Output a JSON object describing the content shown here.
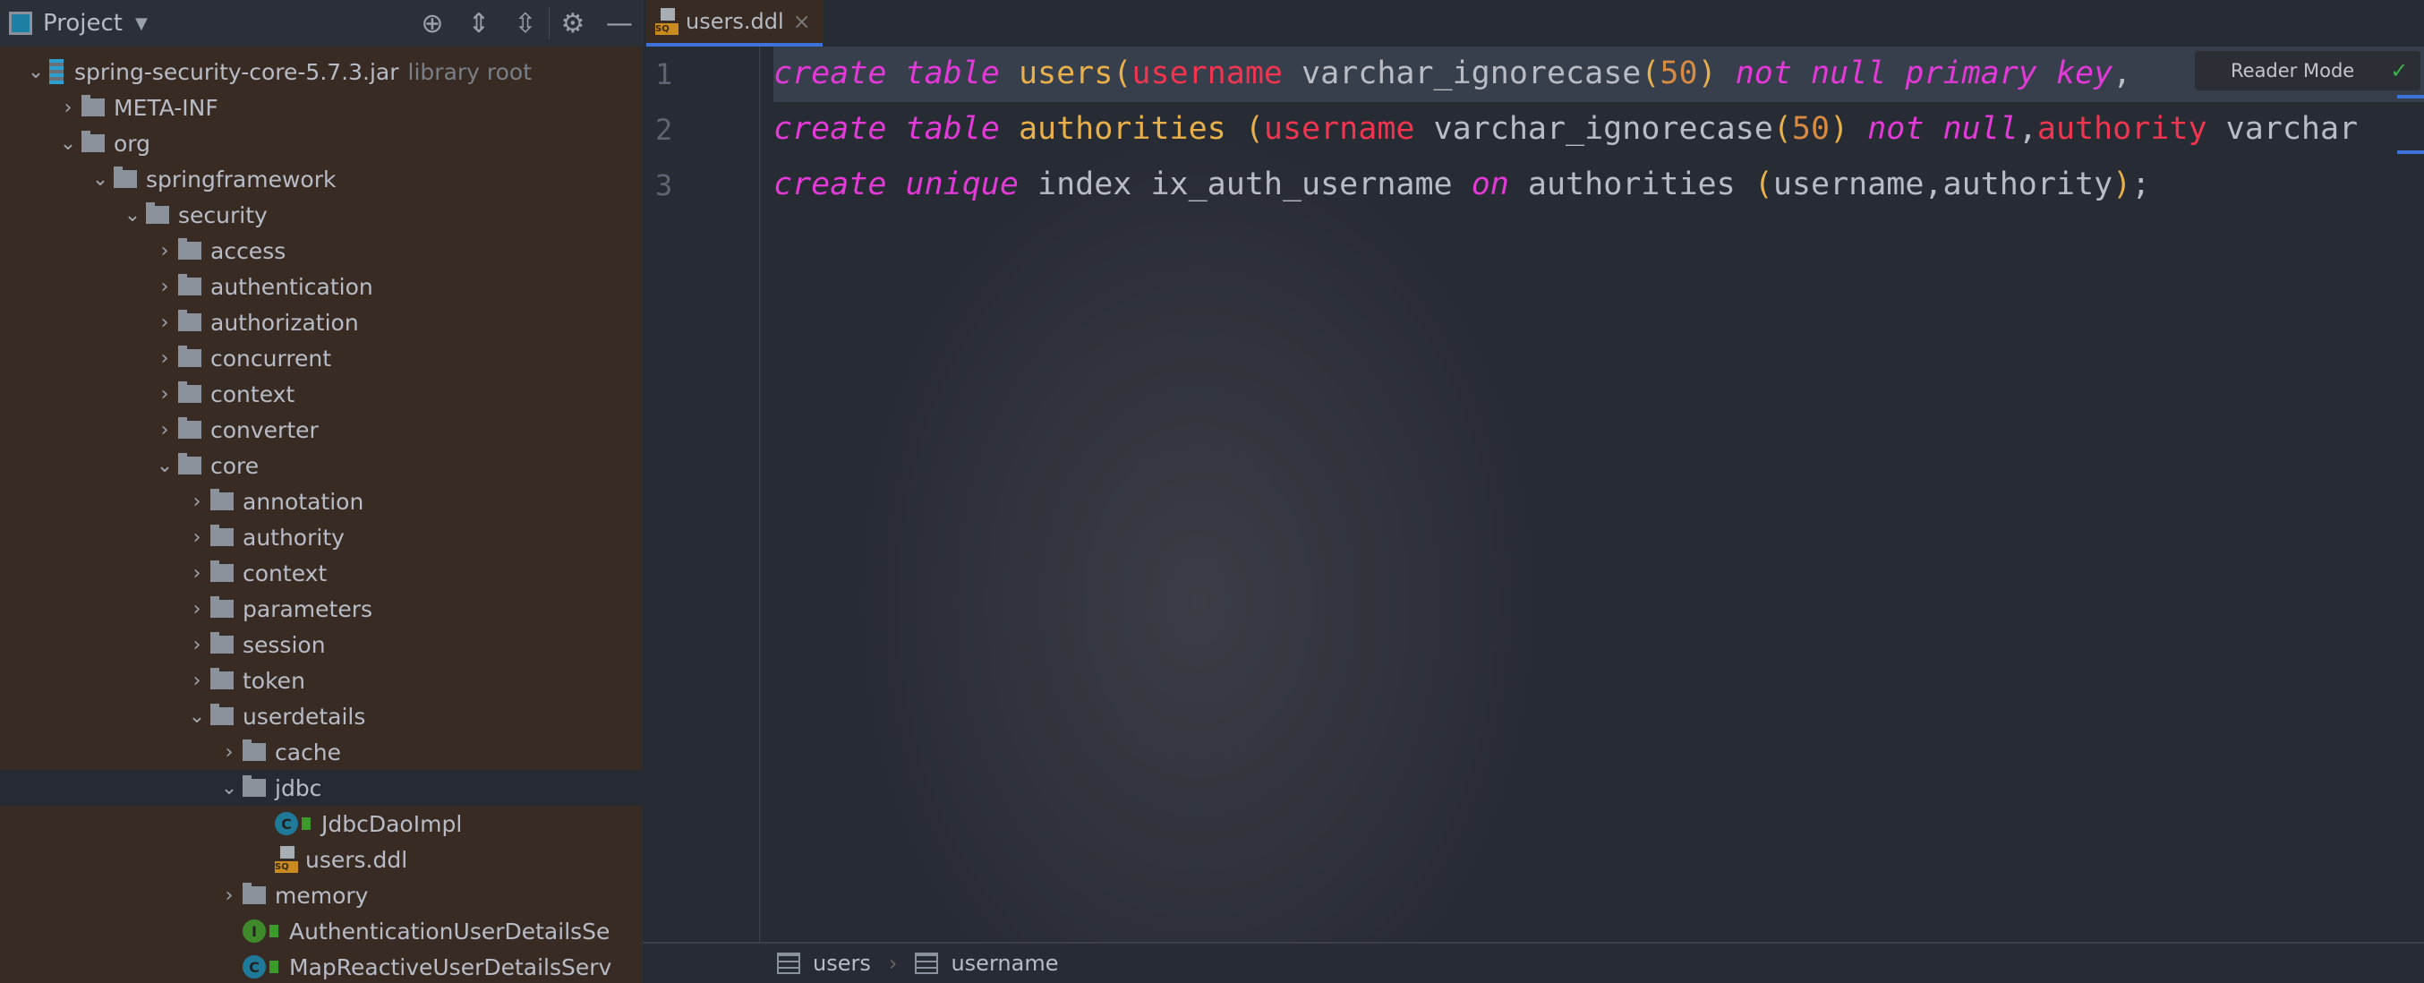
{
  "project_panel": {
    "title": "Project",
    "tools": [
      "locate-icon",
      "expand-all-icon",
      "collapse-all-icon",
      "gear-icon",
      "minimize-icon"
    ],
    "tree": [
      {
        "label": "spring-security-core-5.7.3.jar",
        "suffix": "library root",
        "level": 0,
        "type": "jar",
        "expanded": true
      },
      {
        "label": "META-INF",
        "level": 1,
        "type": "folder",
        "expanded": false
      },
      {
        "label": "org",
        "level": 1,
        "type": "folder",
        "expanded": true
      },
      {
        "label": "springframework",
        "level": 2,
        "type": "folder",
        "expanded": true
      },
      {
        "label": "security",
        "level": 3,
        "type": "folder",
        "expanded": true
      },
      {
        "label": "access",
        "level": 4,
        "type": "folder",
        "expanded": false
      },
      {
        "label": "authentication",
        "level": 4,
        "type": "folder",
        "expanded": false
      },
      {
        "label": "authorization",
        "level": 4,
        "type": "folder",
        "expanded": false
      },
      {
        "label": "concurrent",
        "level": 4,
        "type": "folder",
        "expanded": false
      },
      {
        "label": "context",
        "level": 4,
        "type": "folder",
        "expanded": false
      },
      {
        "label": "converter",
        "level": 4,
        "type": "folder",
        "expanded": false
      },
      {
        "label": "core",
        "level": 4,
        "type": "folder",
        "expanded": true
      },
      {
        "label": "annotation",
        "level": 5,
        "type": "folder",
        "expanded": false
      },
      {
        "label": "authority",
        "level": 5,
        "type": "folder",
        "expanded": false
      },
      {
        "label": "context",
        "level": 5,
        "type": "folder",
        "expanded": false
      },
      {
        "label": "parameters",
        "level": 5,
        "type": "folder",
        "expanded": false
      },
      {
        "label": "session",
        "level": 5,
        "type": "folder",
        "expanded": false
      },
      {
        "label": "token",
        "level": 5,
        "type": "folder",
        "expanded": false
      },
      {
        "label": "userdetails",
        "level": 5,
        "type": "folder",
        "expanded": true
      },
      {
        "label": "cache",
        "level": 6,
        "type": "folder",
        "expanded": false
      },
      {
        "label": "jdbc",
        "level": 6,
        "type": "folder",
        "expanded": true,
        "selected": true
      },
      {
        "label": "JdbcDaoImpl",
        "level": 7,
        "type": "class"
      },
      {
        "label": "users.ddl",
        "level": 7,
        "type": "sql"
      },
      {
        "label": "memory",
        "level": 6,
        "type": "folder",
        "expanded": false
      },
      {
        "label": "AuthenticationUserDetailsSe",
        "level": 6,
        "type": "interface"
      },
      {
        "label": "MapReactiveUserDetailsServ",
        "level": 6,
        "type": "class"
      }
    ]
  },
  "editor": {
    "tab": "users.ddl",
    "reader_mode": "Reader Mode",
    "lines": [
      {
        "n": "1",
        "tokens": [
          [
            "kw",
            "create"
          ],
          [
            "",
            ""
          ],
          [
            "kw",
            " table"
          ],
          [
            "tb",
            " users"
          ],
          [
            "par",
            "("
          ],
          [
            "col",
            "username"
          ],
          [
            "",
            " varchar_ignorecase"
          ],
          [
            "par",
            "("
          ],
          [
            "num",
            "50"
          ],
          [
            "par",
            ")"
          ],
          [
            "kw",
            " not null primary key"
          ],
          [
            "",
            ","
          ]
        ]
      },
      {
        "n": "2",
        "tokens": [
          [
            "kw",
            "create"
          ],
          [
            "kw",
            " table"
          ],
          [
            "tb",
            " authorities "
          ],
          [
            "par",
            "("
          ],
          [
            "col",
            "username"
          ],
          [
            "",
            " varchar_ignorecase"
          ],
          [
            "par",
            "("
          ],
          [
            "num",
            "50"
          ],
          [
            "par",
            ")"
          ],
          [
            "kw",
            " not null"
          ],
          [
            "",
            ","
          ],
          [
            "col",
            "authority"
          ],
          [
            "",
            " varchar"
          ]
        ]
      },
      {
        "n": "3",
        "tokens": [
          [
            "kw",
            "create"
          ],
          [
            "kw",
            " unique"
          ],
          [
            "",
            " index ix_auth_username "
          ],
          [
            "kw",
            "on"
          ],
          [
            "",
            " authorities "
          ],
          [
            "par",
            "("
          ],
          [
            "",
            "username,authority"
          ],
          [
            "par",
            ")"
          ],
          [
            "",
            ";"
          ]
        ]
      }
    ],
    "breadcrumb": [
      "users",
      "username"
    ]
  },
  "colors": {
    "keyword": "#e23ad6",
    "table": "#e8b04a",
    "column": "#f03550",
    "number": "#d68a42",
    "accent": "#3d73d9"
  }
}
